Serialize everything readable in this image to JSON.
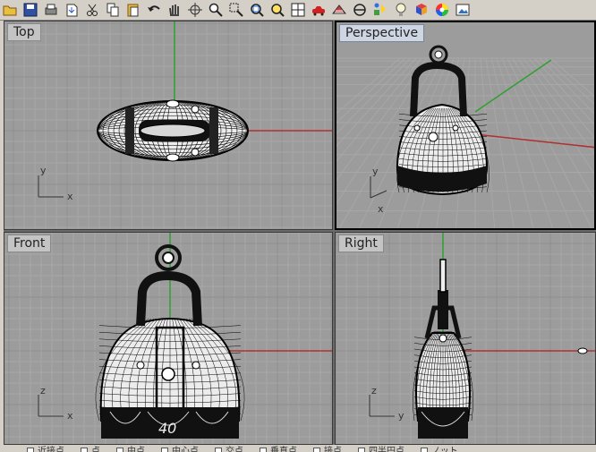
{
  "toolbar": {
    "buttons": [
      {
        "icon": "folder-open-icon"
      },
      {
        "icon": "save-icon"
      },
      {
        "icon": "print-icon"
      },
      {
        "icon": "import-icon"
      },
      {
        "icon": "cut-icon"
      },
      {
        "icon": "copy-icon"
      },
      {
        "icon": "paste-icon"
      },
      {
        "icon": "undo-icon"
      },
      {
        "icon": "pan-hand-icon"
      },
      {
        "icon": "rotate-view-icon"
      },
      {
        "icon": "zoom-icon"
      },
      {
        "icon": "zoom-window-icon"
      },
      {
        "icon": "zoom-extents-icon"
      },
      {
        "icon": "zoom-selected-icon"
      },
      {
        "icon": "viewport-layout-icon"
      },
      {
        "icon": "car-icon"
      },
      {
        "icon": "grid-snap-icon"
      },
      {
        "icon": "cplane-icon"
      },
      {
        "icon": "osnap-icon"
      },
      {
        "icon": "light-bulb-icon"
      },
      {
        "icon": "material-icon"
      },
      {
        "icon": "color-wheel-icon"
      },
      {
        "icon": "render-icon"
      }
    ]
  },
  "viewports": {
    "top": {
      "label": "Top",
      "axis_x": "x",
      "axis_y": "y"
    },
    "perspective": {
      "label": "Perspective",
      "axis_x": "x",
      "axis_y": "y"
    },
    "front": {
      "label": "Front",
      "axis_x": "x",
      "axis_y": "z"
    },
    "right": {
      "label": "Right",
      "axis_x": "y",
      "axis_y": "z"
    }
  },
  "colors": {
    "viewport_bg": "#9c9c9c",
    "grid_minor": "#a7a7a7",
    "grid_major": "#8f8f8f",
    "x_axis": "#b03030",
    "y_axis": "#2fa02f",
    "mesh": "#000000",
    "mesh_fill": "#f2f2f2"
  },
  "status_bar": {
    "snaps": [
      "近接点",
      "点",
      "中点",
      "中心点",
      "交点",
      "垂直点",
      "接点",
      "四半円点",
      "ノット"
    ]
  }
}
